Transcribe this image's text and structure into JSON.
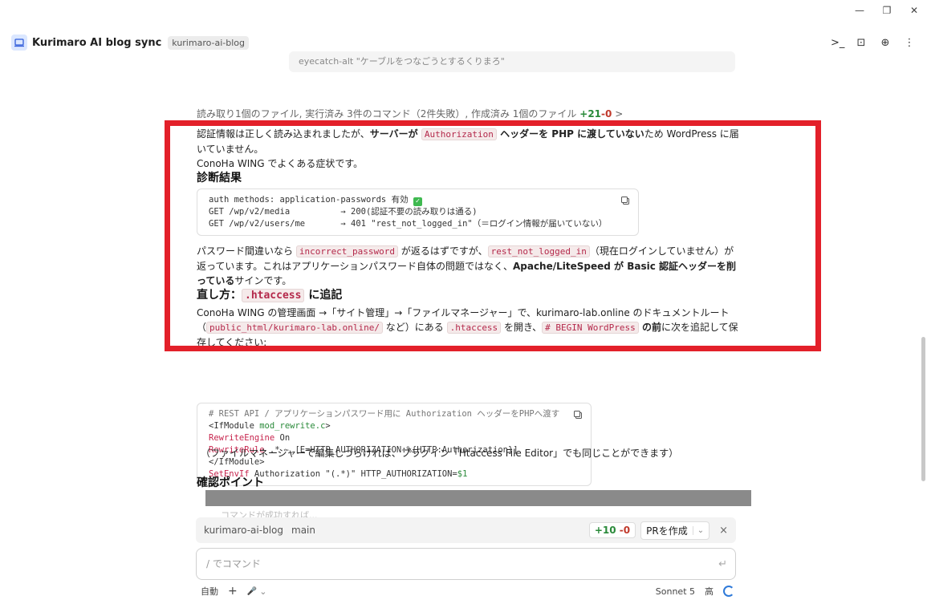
{
  "header": {
    "app_title": "Kurimaro AI blog sync",
    "repo_badge": "kurimaro-ai-blog"
  },
  "top_bubble": {
    "text": "eyecatch-alt \"ケーブルをつなごうとするくりまろ\""
  },
  "summary": {
    "text": "読み取り1個のファイル, 実行済み 3件のコマンド（2件失敗）, 作成済み 1個のファイル",
    "plus": "+21",
    "minus": "-0",
    "chevron": ">"
  },
  "intro": {
    "t1": "認証情報は正しく読み込まれましたが、",
    "b1": "サーバーが ",
    "c1": "Authorization",
    "b2": " ヘッダーを PHP に渡していない",
    "t2": "ため WordPress に届いていません。",
    "t3": "ConoHa WING でよくある症状です。"
  },
  "diag": {
    "heading": "診断結果",
    "line1": "auth methods: application-passwords 有効 ",
    "ok": "✓",
    "line2": "GET /wp/v2/media          → 200(認証不要の読み取りは通る)",
    "line3": "GET /wp/v2/users/me       → 401 \"rest_not_logged_in\"（＝ログイン情報が届いていない）"
  },
  "explain": {
    "t1": "パスワード間違いなら ",
    "c1": "incorrect_password",
    "t2": " が返るはずですが、",
    "c2": "rest_not_logged_in",
    "t3": "（現在ログインしていません）が返っています。これはアプリケーションパスワード自体の問題ではなく、",
    "b1": "Apache/LiteSpeed が Basic 認証ヘッダーを削っている",
    "t4": "サインです。"
  },
  "fix": {
    "heading_pre": "直し方：",
    "heading_code": ".htaccess",
    "heading_post": " に追記",
    "t1": "ConoHa WING の管理画面 →「サイト管理」→「ファイルマネージャー」で、kurimaro-lab.online のドキュメントルート（",
    "c1": "public_html/kurimaro-lab.online/",
    "t2": " など）にある ",
    "c2": ".htaccess",
    "t3": " を開き、",
    "c3": "# BEGIN WordPress",
    "b1": " の前",
    "t4": "に次を追記して保存してください:"
  },
  "htaccess": {
    "comment": "# REST API / アプリケーションパスワード用に Authorization ヘッダーをPHPへ渡す",
    "l2a": "<IfModule ",
    "l2b": "mod_rewrite.c",
    "l2c": ">",
    "l3a": "RewriteEngine",
    "l3b": " On",
    "l4a": "RewriteRule",
    "l4b": " .* - [E=HTTP_AUTHORIZATION:%{HTTP:Authorization}]",
    "l5": "</IfModule>",
    "l6a": "SetEnvIf",
    "l6b": " Authorization \"(.*)\" HTTP_AUTHORIZATION=",
    "l6c": "$1"
  },
  "note": "（ファイルマネージャーで編集しづらければ、プラグイン「Htaccess File Editor」でも同じことができます）",
  "check_heading": "確認ポイント",
  "faded_line": "コマンドが成功すれば...",
  "branchbar": {
    "repo": "kurimaro-ai-blog",
    "branch": "main",
    "plus": "+10",
    "minus": "-0",
    "pr_label": "PRを作成",
    "chevron": "⌄",
    "close": "×"
  },
  "input": {
    "placeholder": "/ でコマンド",
    "enter": "↵"
  },
  "footer": {
    "mode": "自動",
    "plus": "+",
    "mic": "🎤",
    "mic_chev": "⌄",
    "model": "Sonnet 5",
    "effort": "高"
  },
  "winctl": {
    "min": "—",
    "restore": "❐",
    "close": "✕"
  },
  "header_icons": {
    "terminal": ">_",
    "panel": "⊡",
    "globe": "⊕",
    "more": "⋮"
  }
}
